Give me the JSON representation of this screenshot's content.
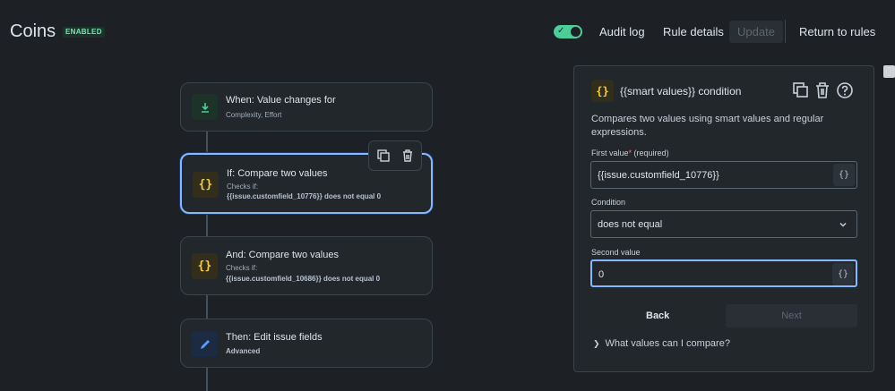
{
  "header": {
    "title": "Coins",
    "badge": "ENABLED",
    "audit_log": "Audit log",
    "rule_details": "Rule details",
    "update": "Update",
    "return": "Return to rules"
  },
  "flow": [
    {
      "title": "When: Value changes for",
      "sub": "Complexity, Effort",
      "bold": "",
      "icon": "download-arrow-icon"
    },
    {
      "title": "If: Compare two values",
      "sub": "Checks if:",
      "bold": "{{issue.customfield_10776}} does not equal 0",
      "icon": "braces-icon"
    },
    {
      "title": "And: Compare two values",
      "sub": "Checks if:",
      "bold": "{{issue.customfield_10686}} does not equal 0",
      "icon": "braces-icon"
    },
    {
      "title": "Then: Edit issue fields",
      "sub": "",
      "bold": "Advanced",
      "icon": "pencil-icon"
    }
  ],
  "panel": {
    "icon_text": "{}",
    "title": "{{smart values}} condition",
    "description": "Compares two values using smart values and regular expressions.",
    "first_label": "First value",
    "required_star": "*",
    "required_text": "(required)",
    "first_value": "{{issue.customfield_10776}}",
    "condition_label": "Condition",
    "condition_value": "does not equal",
    "second_label": "Second value",
    "second_value": "0",
    "smart_btn": "{}",
    "back": "Back",
    "next": "Next",
    "expand": "What values can I compare?"
  },
  "colors": {
    "accent": "#85b8ff",
    "toggle": "#4bce97",
    "background": "#1d2125"
  }
}
